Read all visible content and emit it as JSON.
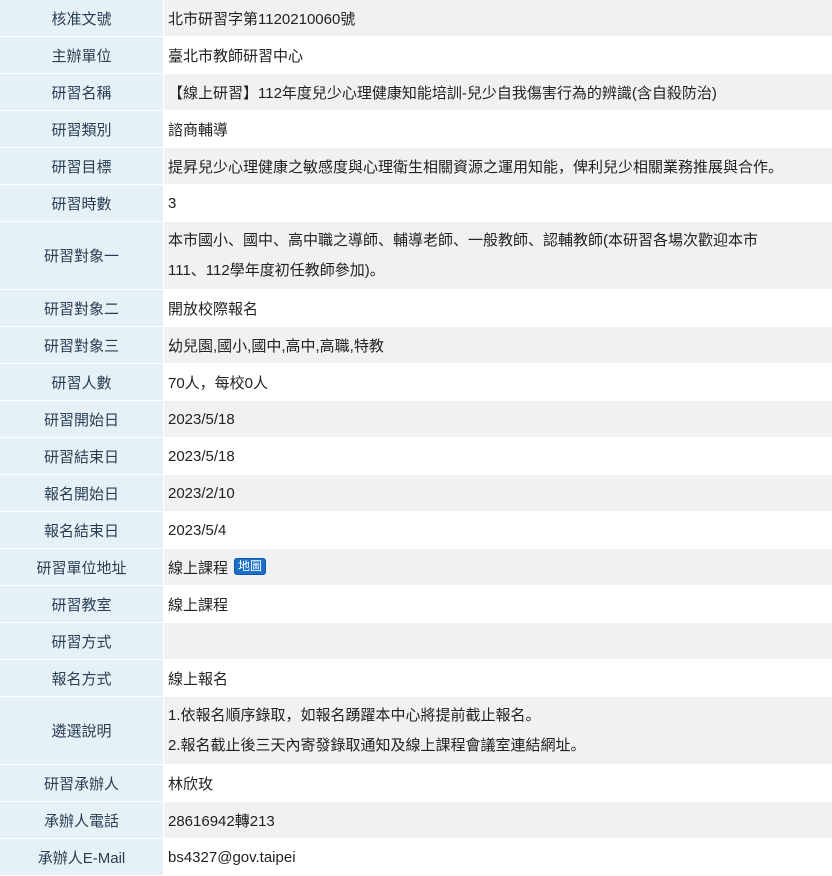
{
  "rows": [
    {
      "label": "核准文號",
      "value": "北市研習字第1120210060號"
    },
    {
      "label": "主辦單位",
      "value": "臺北市教師研習中心"
    },
    {
      "label": "研習名稱",
      "value": "【線上研習】112年度兒少心理健康知能培訓-兒少自我傷害行為的辨識(含自殺防治)"
    },
    {
      "label": "研習類別",
      "value": "諮商輔導"
    },
    {
      "label": "研習目標",
      "value": "提昇兒少心理健康之敏感度與心理衛生相關資源之運用知能，俾利兒少相關業務推展與合作。"
    },
    {
      "label": "研習時數",
      "value": "3"
    },
    {
      "label": "研習對象一",
      "line1": "本市國小、國中、高中職之導師、輔導老師、一般教師、認輔教師(本研習各場次歡迎本市",
      "line2": "111、112學年度初任教師參加)。"
    },
    {
      "label": "研習對象二",
      "value": "開放校際報名"
    },
    {
      "label": "研習對象三",
      "value": "幼兒園,國小,國中,高中,高職,特教"
    },
    {
      "label": "研習人數",
      "value": "70人，每校0人"
    },
    {
      "label": "研習開始日",
      "value": "2023/5/18"
    },
    {
      "label": "研習結束日",
      "value": "2023/5/18"
    },
    {
      "label": "報名開始日",
      "value": "2023/2/10"
    },
    {
      "label": "報名結束日",
      "value": "2023/5/4"
    },
    {
      "label": "研習單位地址",
      "value": "線上課程",
      "badge": "地圖"
    },
    {
      "label": "研習教室",
      "value": "線上課程"
    },
    {
      "label": "研習方式",
      "value": ""
    },
    {
      "label": "報名方式",
      "value": "線上報名"
    },
    {
      "label": "遴選說明",
      "line1": "1.依報名順序錄取，如報名踴躍本中心將提前截止報名。",
      "line2": "2.報名截止後三天內寄發錄取通知及線上課程會議室連結網址。"
    },
    {
      "label": "研習承辦人",
      "value": "林欣玫"
    },
    {
      "label": "承辦人電話",
      "value": "28616942轉213"
    },
    {
      "label": "承辦人E-Mail",
      "value": "bs4327@gov.taipei"
    }
  ],
  "colors": {
    "label_bg": "#e6f0f7",
    "stripe_bg": "#f1f1f1",
    "badge_bg": "#1a6fc9"
  }
}
